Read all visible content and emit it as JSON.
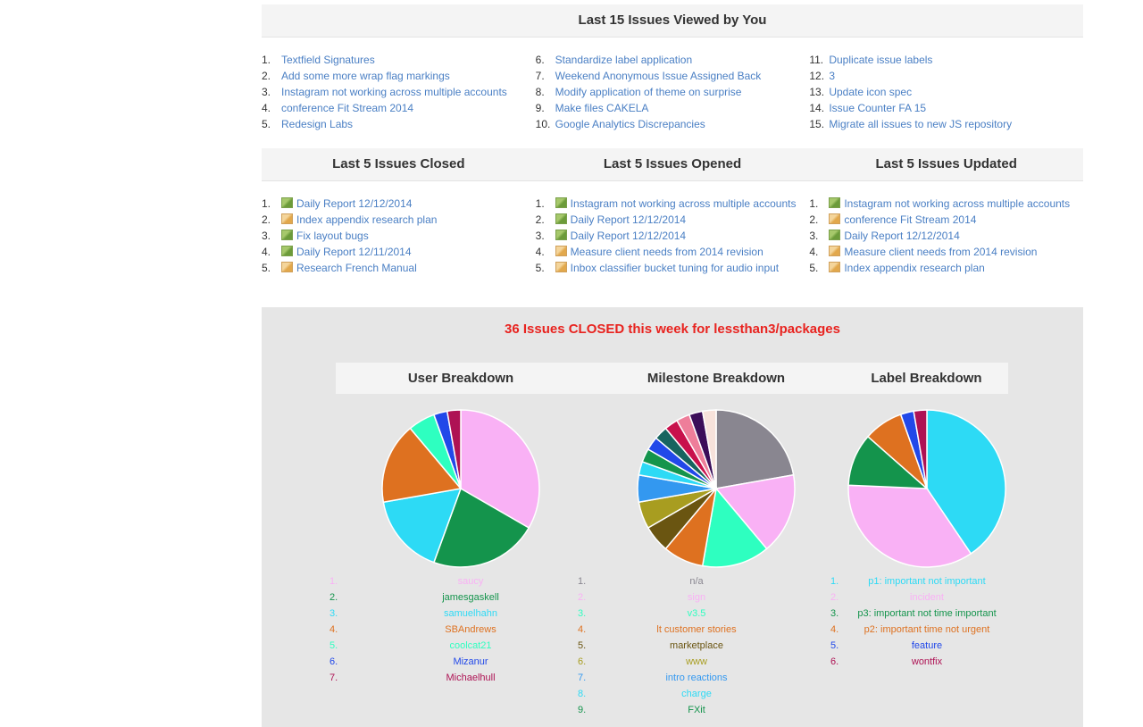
{
  "recent": {
    "title": "Last 15 Issues Viewed by You",
    "items": [
      "Textfield Signatures",
      "Add some more wrap flag markings",
      "Instagram not working across multiple accounts",
      "conference Fit Stream 2014",
      "Redesign Labs",
      "Standardize label application",
      "Weekend Anonymous Issue Assigned Back",
      "Modify application of theme on surprise",
      "Make files CAKELA",
      "Google Analytics Discrepancies",
      "Duplicate issue labels",
      "3",
      "Update icon spec",
      "Issue Counter FA 15",
      "Migrate all issues to new JS repository"
    ]
  },
  "closed": {
    "title": "Last 5 Issues Closed",
    "items": [
      {
        "text": "Daily Report 12/12/2014",
        "icon": "green"
      },
      {
        "text": "Index appendix research plan",
        "icon": "orange"
      },
      {
        "text": "Fix layout bugs",
        "icon": "green"
      },
      {
        "text": "Daily Report 12/11/2014",
        "icon": "green"
      },
      {
        "text": "Research French Manual",
        "icon": "orange"
      }
    ]
  },
  "opened": {
    "title": "Last 5 Issues Opened",
    "items": [
      {
        "text": "Instagram not working across multiple accounts",
        "icon": "green"
      },
      {
        "text": "Daily Report 12/12/2014",
        "icon": "green"
      },
      {
        "text": "Daily Report 12/12/2014",
        "icon": "green"
      },
      {
        "text": "Measure client needs from 2014 revision",
        "icon": "orange"
      },
      {
        "text": "Inbox classifier bucket tuning for audio input",
        "icon": "orange"
      }
    ]
  },
  "updated": {
    "title": "Last 5 Issues Updated",
    "items": [
      {
        "text": "Instagram not working across multiple accounts",
        "icon": "green"
      },
      {
        "text": "conference Fit Stream 2014",
        "icon": "orange"
      },
      {
        "text": "Daily Report 12/12/2014",
        "icon": "green"
      },
      {
        "text": "Measure client needs from 2014 revision",
        "icon": "orange"
      },
      {
        "text": "Index appendix research plan",
        "icon": "orange"
      }
    ]
  },
  "stats": {
    "title": "36 Issues CLOSED this week for lessthan3/packages"
  },
  "breakdowns": {
    "user_title": "User Breakdown",
    "milestone_title": "Milestone Breakdown",
    "label_title": "Label Breakdown"
  },
  "chart_data": [
    {
      "type": "pie",
      "title": "User Breakdown",
      "slices": [
        {
          "label": "saucy",
          "value": 12,
          "color": "#f9b1f5"
        },
        {
          "label": "jamesgaskell",
          "value": 8,
          "color": "#14944c"
        },
        {
          "label": "samuelhahn",
          "value": 6,
          "color": "#2ddaf5"
        },
        {
          "label": "SBAndrews",
          "value": 6,
          "color": "#de7120"
        },
        {
          "label": "coolcat21",
          "value": 2,
          "color": "#2effc0"
        },
        {
          "label": "Mizanur",
          "value": 1,
          "color": "#2148e9"
        },
        {
          "label": "Michaelhull",
          "value": 1,
          "color": "#ae1254"
        }
      ]
    },
    {
      "type": "pie",
      "title": "Milestone Breakdown",
      "slices": [
        {
          "label": "n/a",
          "value": 8,
          "color": "#898690"
        },
        {
          "label": "sign",
          "value": 6,
          "color": "#f9b1f5"
        },
        {
          "label": "v3.5",
          "value": 5,
          "color": "#2effc0"
        },
        {
          "label": "lt customer stories",
          "value": 3,
          "color": "#de7120"
        },
        {
          "label": "marketplace",
          "value": 2,
          "color": "#6a5511"
        },
        {
          "label": "www",
          "value": 2,
          "color": "#a89d20"
        },
        {
          "label": "intro reactions",
          "value": 2,
          "color": "#3398f0"
        },
        {
          "label": "charge",
          "value": 1,
          "color": "#2ddaf5"
        },
        {
          "label": "FXit",
          "value": 1,
          "color": "#14944c"
        },
        {
          "label": "",
          "value": 1,
          "color": "#2148e9"
        },
        {
          "label": "",
          "value": 1,
          "color": "#17645f"
        },
        {
          "label": "",
          "value": 1,
          "color": "#c8114c"
        },
        {
          "label": "",
          "value": 1,
          "color": "#ee7e9a"
        },
        {
          "label": "",
          "value": 1,
          "color": "#3b0d59"
        },
        {
          "label": "",
          "value": 1,
          "color": "#f7e2db"
        }
      ]
    },
    {
      "type": "pie",
      "title": "Label Breakdown",
      "slices": [
        {
          "label": "p1: important not important",
          "value": 15,
          "color": "#2ddaf5"
        },
        {
          "label": "incident",
          "value": 13,
          "color": "#f9b1f5"
        },
        {
          "label": "p3: important not time important",
          "value": 4,
          "color": "#14944c"
        },
        {
          "label": "p2: important time not urgent",
          "value": 3,
          "color": "#de7120"
        },
        {
          "label": "feature",
          "value": 1,
          "color": "#2148e9"
        },
        {
          "label": "wontfix",
          "value": 1,
          "color": "#ae1254"
        }
      ]
    }
  ]
}
